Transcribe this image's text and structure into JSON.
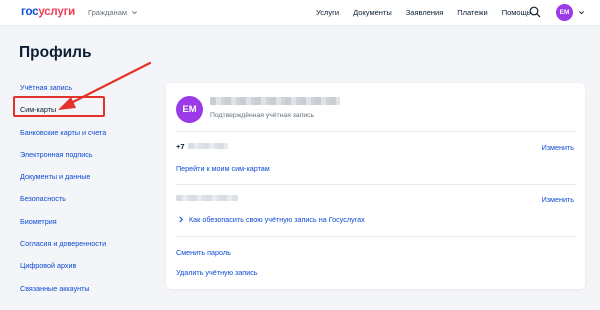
{
  "colors": {
    "brand_blue": "#0d4cd3",
    "brand_red": "#ee3f58",
    "avatar": "#9b3be8",
    "highlight": "#e3332d"
  },
  "header": {
    "logo_part1": "гос",
    "logo_part2": "услуги",
    "role_label": "Гражданам",
    "nav": [
      "Услуги",
      "Документы",
      "Заявления",
      "Платежи",
      "Помощь"
    ],
    "avatar_initials": "ЕМ"
  },
  "page": {
    "title": "Профиль"
  },
  "sidebar": {
    "items": [
      {
        "label": "Учётная запись"
      },
      {
        "label": "Сим-карты"
      },
      {
        "label": "Банковские карты и счета"
      },
      {
        "label": "Электронная подпись"
      },
      {
        "label": "Документы и данные"
      },
      {
        "label": "Безопасность"
      },
      {
        "label": "Биометрия"
      },
      {
        "label": "Согласия и доверенности"
      },
      {
        "label": "Цифровой архив"
      },
      {
        "label": "Связанные аккаунты"
      }
    ]
  },
  "card": {
    "avatar_initials": "ЕМ",
    "account_status": "Подтверждённая учётная запись",
    "phone_prefix": "+7",
    "change_label_1": "Изменить",
    "sim_link": "Перейти к моим сим-картам",
    "change_label_2": "Изменить",
    "security_link": "Как обезопасить свою учётную запись на Госуслугах",
    "change_password": "Сменить пароль",
    "delete_account": "Удалить учётную запись"
  }
}
